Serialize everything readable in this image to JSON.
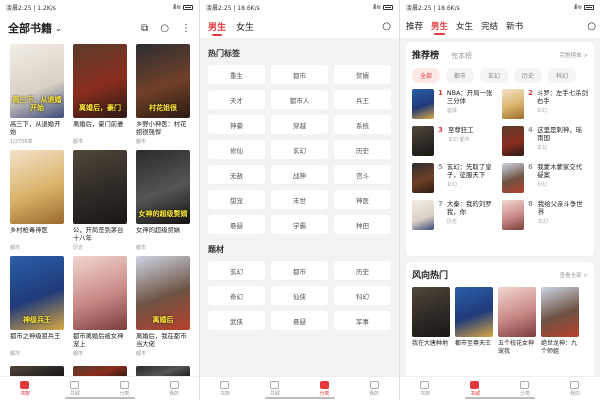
{
  "status": {
    "left1": "凌晨2:25 | 1.2K/s",
    "left2": "凌晨2:25 | 18.6K/s",
    "left3": "凌晨2:25 | 18.6K/s",
    "battery": "",
    "sig": "ıll ≋"
  },
  "bookshelf": {
    "title": "全部书籍",
    "books": [
      {
        "title": "高三下，从退婚开始",
        "sub": "1/2706章",
        "cover_text": "高三下，从退婚开始"
      },
      {
        "title": "离婚后，豪门前妻",
        "sub": "都市",
        "cover_text": "离婚后，豪门"
      },
      {
        "title": "乡野小神医：村花姐很强悍",
        "sub": "都市",
        "cover_text": "村花姐很"
      },
      {
        "title": "乡村枪毒神医",
        "sub": "都市",
        "cover_text": ""
      },
      {
        "title": "公，开局签到茅台十八年",
        "sub": "历史",
        "cover_text": ""
      },
      {
        "title": "女神的超级赘婿",
        "sub": "都市",
        "cover_text": "女神的超级赘婿"
      },
      {
        "title": "都市之神级狙兵王",
        "sub": "都市",
        "cover_text": "神级兵王"
      },
      {
        "title": "都市离婚后被女神宠上",
        "sub": "都市",
        "cover_text": ""
      },
      {
        "title": "离婚后，我在都市当大佬",
        "sub": "都市",
        "cover_text": "离婚后"
      }
    ]
  },
  "category": {
    "tab_male": "男生",
    "tab_female": "女生",
    "hot_tags_title": "热门标签",
    "hot_tags": [
      "重生",
      "都市",
      "赘婿",
      "天才",
      "都市人",
      "兵王",
      "神豪",
      "穿越",
      "系统",
      "修仙",
      "玄幻",
      "历史",
      "无敌",
      "战神",
      "宫斗",
      "甜宠",
      "末世",
      "神医",
      "悬疑",
      "学霸",
      "种田"
    ],
    "theme_title": "题材",
    "themes": [
      "玄幻",
      "都市",
      "历史",
      "奇幻",
      "仙侠",
      "科幻",
      "武侠",
      "悬疑",
      "军事"
    ]
  },
  "discover": {
    "tabs": [
      "推荐",
      "男生",
      "女生",
      "完结",
      "新书",
      "",
      ""
    ],
    "rank_title": "推荐榜",
    "rank_sub": "完本榜",
    "rank_more": "完整榜单 >",
    "chips": [
      "全部",
      "都市",
      "玄幻",
      "历史",
      "科幻"
    ],
    "ranks": [
      {
        "num": "1",
        "title": "NBA：开局一张三分体",
        "sub": "篮球"
      },
      {
        "num": "2",
        "title": "斗罗：左手七杀剑右手",
        "sub": "玄幻"
      },
      {
        "num": "3",
        "title": "至尊狂工",
        "sub": "玄幻·都市"
      },
      {
        "num": "4",
        "title": "这里是刺神，瑶雨国",
        "sub": "玄幻"
      },
      {
        "num": "5",
        "title": "玄幻：先取了皇子，征服天下",
        "sub": "玄幻"
      },
      {
        "num": "6",
        "title": "我蒙木蒙家交代疑案",
        "sub": "科幻"
      },
      {
        "num": "7",
        "title": "大秦：我的刘罗我，你",
        "sub": "历史"
      },
      {
        "num": "8",
        "title": "我给父亲斗争世界",
        "sub": "玄幻"
      }
    ],
    "wind_title": "风向热门",
    "wind_more": "查看全部 >",
    "wind_books": [
      {
        "title": "我在大唐种地"
      },
      {
        "title": "都市至尊天王"
      },
      {
        "title": "五个校花女神宠我"
      },
      {
        "title": "绝世龙神：九个师姐"
      }
    ]
  },
  "nav": {
    "shelf": "书架",
    "store": "书城",
    "category": "分类",
    "mine": "我的"
  }
}
